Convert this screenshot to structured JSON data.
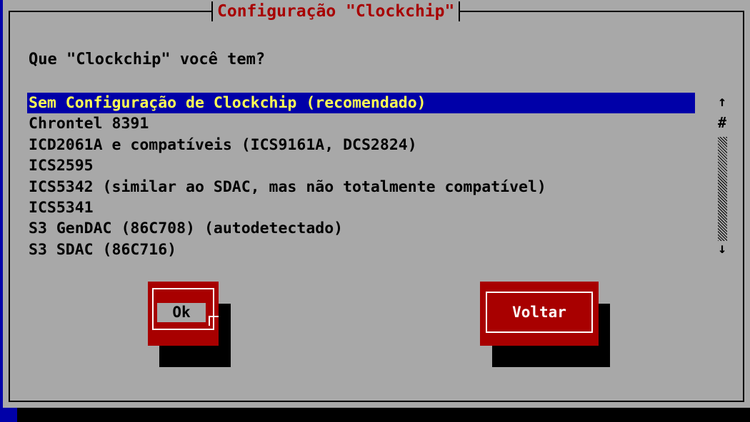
{
  "dialog": {
    "title": "Configuração \"Clockchip\"",
    "prompt": "Que \"Clockchip\" você tem?"
  },
  "list": {
    "selected_index": 0,
    "items": [
      "Sem Configuração de Clockchip (recomendado)",
      "Chrontel 8391",
      "ICD2061A e compatíveis (ICS9161A, DCS2824)",
      "ICS2595",
      "ICS5342 (similar ao SDAC, mas não totalmente compatível)",
      "ICS5341",
      "S3 GenDAC (86C708) (autodetectado)",
      "S3 SDAC (86C716)"
    ]
  },
  "scrollbar": {
    "up_glyph": "↑",
    "thumb_glyph": "#",
    "down_glyph": "↓"
  },
  "buttons": {
    "ok_label": "Ok",
    "back_label": "Voltar"
  },
  "colors": {
    "desktop": "#0000a8",
    "window": "#a8a8a8",
    "title_text": "#a80000",
    "selection_bg": "#0000a8",
    "selection_text": "#ffff55",
    "button_bg": "#a80000",
    "button_text": "#ffffff"
  }
}
